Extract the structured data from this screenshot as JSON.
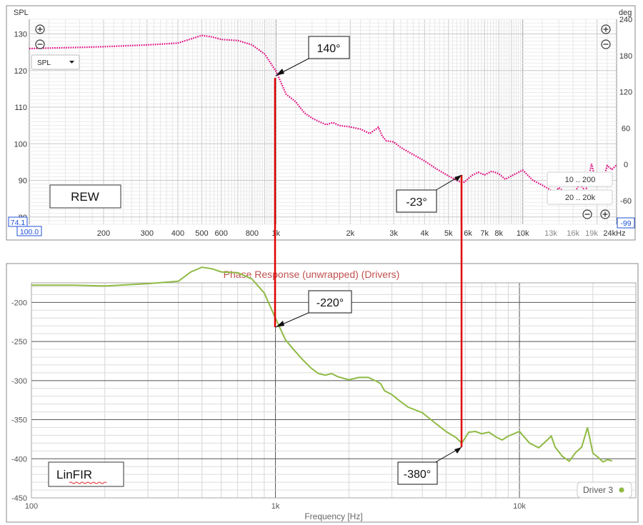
{
  "colors": {
    "spl_trace": "#e0007a",
    "phase_trace": "#8fba44",
    "marker_lines": "#e00000",
    "title_red": "#c0504d",
    "blue_box": "#1f4fd8"
  },
  "rew": {
    "watermark": "REW",
    "left_axis_title": "SPL",
    "right_axis_title": "deg",
    "dropdown_label": "SPL",
    "range_box_1": "10 .. 200",
    "range_box_2": "20 .. 20k",
    "readout_left": "74.1",
    "readout_x": "100.0",
    "readout_right": "-99",
    "y_ticks_left": [
      "130",
      "120",
      "110",
      "100",
      "90",
      "80"
    ],
    "y_ticks_right": [
      "240",
      "180",
      "120",
      "60",
      "0",
      "-60"
    ],
    "x_ticks": [
      "200",
      "300",
      "400",
      "500",
      "600",
      "800",
      "1k",
      "2k",
      "3k",
      "4k",
      "5k",
      "6k",
      "7k",
      "8k",
      "10k",
      "13k",
      "16k",
      "19k",
      "24kHz"
    ],
    "callouts": [
      {
        "text": "140°"
      },
      {
        "text": "-23°"
      }
    ]
  },
  "linfir": {
    "title": "Phase Response (unwrapped) (Drivers)",
    "watermark": "LinFIR",
    "x_axis_title": "Frequency [Hz]",
    "legend": "Driver 3",
    "y_ticks": [
      "-200",
      "-250",
      "-300",
      "-350",
      "-400",
      "-450"
    ],
    "x_ticks": [
      "100",
      "1k",
      "10k"
    ],
    "callouts": [
      {
        "text": "-220°"
      },
      {
        "text": "-380°"
      }
    ]
  },
  "chart_data": [
    {
      "type": "line",
      "panel": "REW",
      "title": "",
      "ylabel": "SPL",
      "y2label": "deg",
      "x_scale": "log",
      "xlim": [
        100,
        24000
      ],
      "ylim": [
        78,
        134
      ],
      "y2lim": [
        -99,
        240
      ],
      "grid": true,
      "series": [
        {
          "name": "SPL",
          "x": [
            100,
            150,
            200,
            300,
            400,
            450,
            500,
            550,
            600,
            700,
            800,
            900,
            1000,
            1100,
            1200,
            1300,
            1400,
            1500,
            1600,
            1700,
            1800,
            2000,
            2200,
            2400,
            2600,
            2700,
            2800,
            3000,
            3200,
            3500,
            4000,
            4500,
            5000,
            5500,
            5800,
            6200,
            6600,
            7000,
            7500,
            8000,
            8500,
            9000,
            10000,
            11000,
            12000,
            13000,
            13500,
            14000,
            15000,
            16000,
            17000,
            18000,
            19000,
            20000,
            21000,
            22000,
            23000,
            24000
          ],
          "values": [
            126,
            126.3,
            126.5,
            127,
            127.5,
            128.6,
            129.6,
            129.2,
            128.5,
            128.2,
            127,
            124.5,
            119.8,
            113.5,
            111.5,
            108.5,
            107,
            106,
            105.2,
            105.8,
            105,
            104.6,
            104,
            102.8,
            104.5,
            102,
            100.8,
            100.5,
            99,
            97.5,
            95.3,
            93,
            91.2,
            89.7,
            89.5,
            91.3,
            92.2,
            91.5,
            92.5,
            91.8,
            90.3,
            91.2,
            92.8,
            90,
            88.7,
            87.3,
            86.8,
            88,
            86.5,
            86,
            89,
            87,
            94.5,
            88.5,
            89.5,
            94,
            93,
            94.2
          ]
        }
      ],
      "annotations": [
        {
          "x": 1000,
          "label": "140°"
        },
        {
          "x": 5800,
          "label": "-23°"
        }
      ]
    },
    {
      "type": "line",
      "panel": "LinFIR",
      "title": "Phase Response (unwrapped) (Drivers)",
      "xlabel": "Frequency [Hz]",
      "ylabel": "",
      "x_scale": "log",
      "xlim": [
        100,
        30000
      ],
      "ylim": [
        -450,
        -175
      ],
      "grid": true,
      "legend_position": "bottom-right",
      "series": [
        {
          "name": "Driver 3",
          "x": [
            100,
            150,
            200,
            300,
            400,
            450,
            500,
            550,
            600,
            700,
            800,
            900,
            1000,
            1100,
            1200,
            1300,
            1400,
            1500,
            1600,
            1700,
            1800,
            2000,
            2200,
            2400,
            2600,
            2700,
            2800,
            3000,
            3200,
            3500,
            4000,
            4500,
            5000,
            5500,
            5800,
            6200,
            6600,
            7000,
            7500,
            8000,
            8500,
            9000,
            10000,
            11000,
            12000,
            13000,
            13500,
            14000,
            15000,
            16000,
            17000,
            18000,
            19000,
            20000,
            21000,
            22000,
            23000,
            24000
          ],
          "values": [
            -178,
            -178,
            -179,
            -176,
            -173,
            -161,
            -155,
            -157,
            -161,
            -162,
            -170,
            -188,
            -220,
            -248,
            -262,
            -274,
            -284,
            -291,
            -293,
            -291,
            -295,
            -299,
            -296,
            -296,
            -301,
            -304,
            -313,
            -318,
            -325,
            -334,
            -341,
            -354,
            -365,
            -373,
            -380,
            -366,
            -365,
            -368,
            -366,
            -372,
            -376,
            -371,
            -365,
            -380,
            -386,
            -376,
            -371,
            -385,
            -397,
            -403,
            -392,
            -385,
            -360,
            -393,
            -398,
            -404,
            -401,
            -403
          ]
        }
      ],
      "annotations": [
        {
          "x": 1000,
          "label": "-220°"
        },
        {
          "x": 5800,
          "label": "-380°"
        }
      ]
    }
  ]
}
